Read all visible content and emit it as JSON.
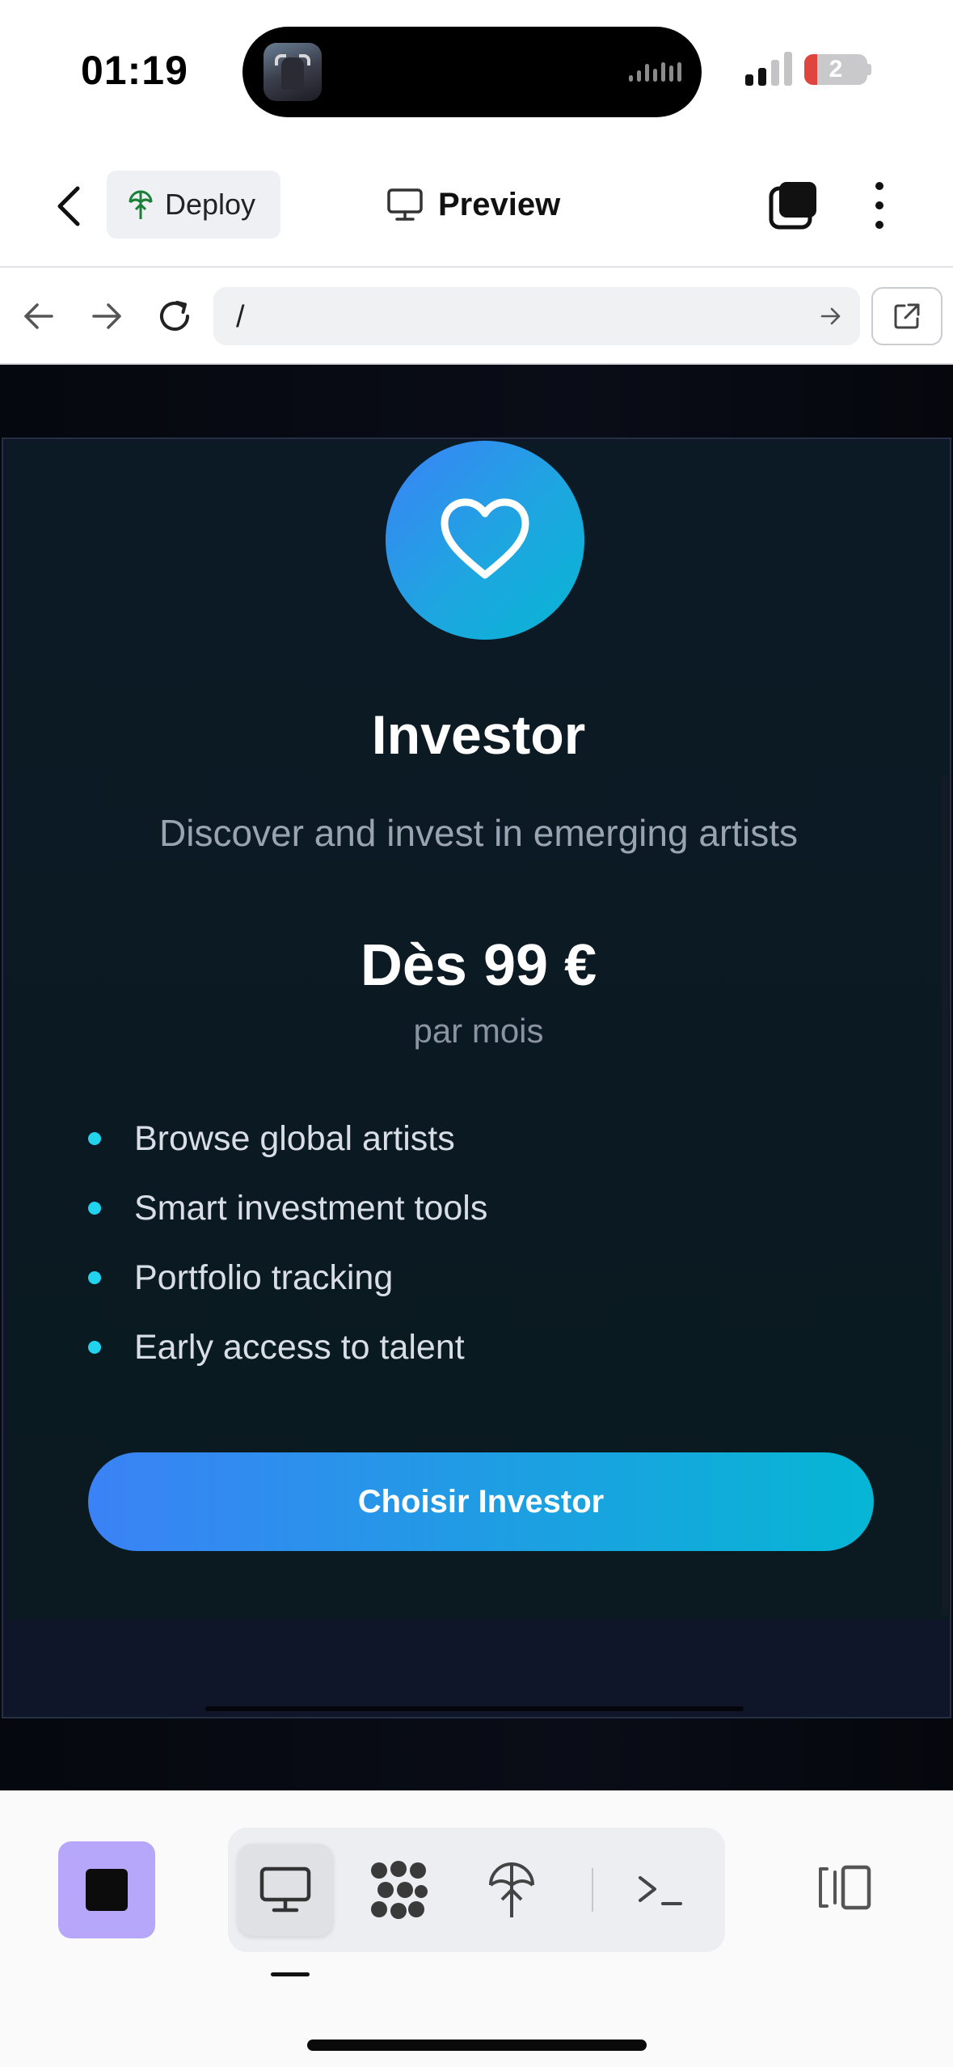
{
  "status_bar": {
    "time": "01:19",
    "battery_level": "2",
    "battery_fraction": 0.2,
    "signal_bars_active": 2,
    "colors": {
      "battery_low": "#e0443e"
    }
  },
  "header": {
    "back_icon": "chevron-left-icon",
    "deploy_label": "Deploy",
    "preview_label": "Preview",
    "tabs_icon": "tabs-stack-icon",
    "more_icon": "more-vertical-icon"
  },
  "url_bar": {
    "path": "/",
    "icons": [
      "arrow-left-icon",
      "arrow-right-icon",
      "reload-icon",
      "arrow-go-icon",
      "external-link-icon"
    ]
  },
  "card": {
    "icon": "heart-icon",
    "title": "Investor",
    "subtitle": "Discover and invest in emerging artists",
    "price": "Dès 99 €",
    "period": "par mois",
    "features": [
      "Browse global artists",
      "Smart investment tools",
      "Portfolio tracking",
      "Early access to talent"
    ],
    "cta": "Choisir Investor",
    "colors": {
      "gradient_start": "#3b82f6",
      "gradient_end": "#06b6d4",
      "bullet": "#22d3ee",
      "background": "#0c1a26"
    }
  },
  "bottom_bar": {
    "stop_color": "#b6a7fb",
    "tools": [
      "monitor-icon",
      "workflow-dots-icon",
      "deploy-icon",
      "terminal-icon"
    ],
    "active_tool": "monitor-icon",
    "split_icon": "split-view-icon"
  }
}
